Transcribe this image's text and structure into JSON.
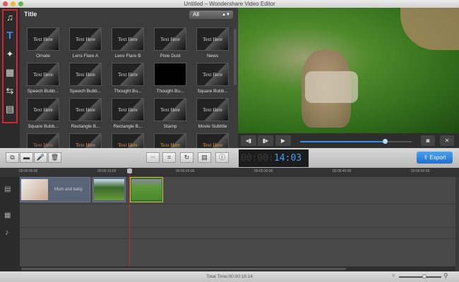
{
  "window": {
    "title": "Untitled – Wondershare Video Editor"
  },
  "sidebar": {
    "items": [
      {
        "name": "media",
        "icon": "media-music-icon",
        "glyph": "♫"
      },
      {
        "name": "text",
        "icon": "text-title-icon",
        "glyph": "T"
      },
      {
        "name": "effects",
        "icon": "magic-wand-icon",
        "glyph": "✦"
      },
      {
        "name": "pip",
        "icon": "picture-in-picture-icon",
        "glyph": "▦"
      },
      {
        "name": "transitions",
        "icon": "transition-icon",
        "glyph": "⇆"
      },
      {
        "name": "intro",
        "icon": "clapper-icon",
        "glyph": "▤"
      }
    ]
  },
  "library": {
    "title": "Title",
    "filter": "All",
    "items": [
      {
        "label": "Ornate",
        "thumb": "Text Here"
      },
      {
        "label": "Lens Flare A",
        "thumb": "Text Here"
      },
      {
        "label": "Lens Flare B",
        "thumb": "Text Here"
      },
      {
        "label": "Pixie Dust",
        "thumb": "Text Here"
      },
      {
        "label": "News",
        "thumb": "Text Here"
      },
      {
        "label": "Speech Bubb...",
        "thumb": "Text Here"
      },
      {
        "label": "Speech Bubb...",
        "thumb": "Text Here"
      },
      {
        "label": "Thought Bu...",
        "thumb": "Text Here"
      },
      {
        "label": "Thought Bu...",
        "thumb": ""
      },
      {
        "label": "Square Bubb...",
        "thumb": "Text Here"
      },
      {
        "label": "Square Bubb...",
        "thumb": "Text Here"
      },
      {
        "label": "Rectangle B...",
        "thumb": "Text Here"
      },
      {
        "label": "Rectangle B...",
        "thumb": "Text Here"
      },
      {
        "label": "Stamp",
        "thumb": "Text Here"
      },
      {
        "label": "Movie Subtitle",
        "thumb": "Text Here"
      },
      {
        "label": "",
        "thumb": "Text Here"
      },
      {
        "label": "",
        "thumb": "Text Here"
      },
      {
        "label": "",
        "thumb": "Text Here"
      },
      {
        "label": "",
        "thumb": "Text Here"
      },
      {
        "label": "",
        "thumb": "Text Here"
      }
    ]
  },
  "player": {
    "progress": 0.77,
    "buttons": [
      "◂▮",
      "▮▸",
      "▶"
    ],
    "snapshot": "◙",
    "fullscreen": "✕"
  },
  "toolbar": {
    "left": [
      "⧉",
      "▬",
      "🎤",
      "🗑"
    ],
    "mid": [
      "✂",
      "⌗",
      "↻",
      "▤",
      "ⓘ"
    ],
    "timecode_dim": "00:00:",
    "timecode_lit": "14:03",
    "export": "Export"
  },
  "ruler": [
    "00:00:00:00",
    "00:00:10:00",
    "00:00:20:00",
    "00:00:30:00",
    "00:00:40:00",
    "00:00:50:00"
  ],
  "timeline": {
    "clips": [
      {
        "label": "Mum and baby"
      },
      {
        "label": ""
      },
      {
        "label": ""
      }
    ],
    "track_icons": [
      "▤",
      "▦",
      "♪"
    ]
  },
  "status": {
    "total_time": "Total Time:00:00:18:14"
  },
  "colors": {
    "accent": "#1c6fd0",
    "playhead": "#c8242a",
    "selection": "#e0202a"
  }
}
